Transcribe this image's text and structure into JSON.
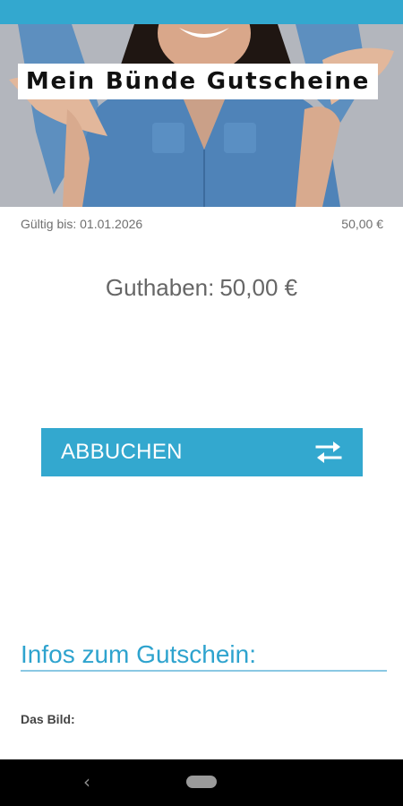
{
  "hero": {
    "title": "Mein Bünde Gutscheine"
  },
  "voucher": {
    "valid_until": "Gültig bis: 01.01.2026",
    "amount": "50,00 €",
    "balance_label": "Guthaben:",
    "balance_value": "50,00 €"
  },
  "actions": {
    "abbuchen_label": "ABBUCHEN",
    "abbuchen_icon": "swap-arrows-icon"
  },
  "info": {
    "section_title": "Infos zum Gutschein:",
    "image_label": "Das Bild:"
  },
  "navigation": {
    "back_icon": "back-chevron-icon",
    "home_icon": "home-pill-icon"
  },
  "colors": {
    "accent": "#33a8cf",
    "title_blue": "#2ea3ce",
    "nav_bar": "#000000"
  }
}
